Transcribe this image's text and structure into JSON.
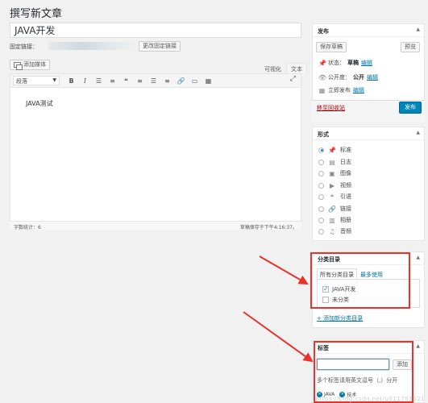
{
  "page": {
    "title": "撰写新文章"
  },
  "post": {
    "title_value": "JAVA开发",
    "permalink_label": "固定链接：",
    "change_permalink_label": "更改固定链接",
    "content": "JAVA测试"
  },
  "editor": {
    "add_media_label": "添加媒体",
    "tabs": [
      "可视化",
      "文本"
    ],
    "format_select": "段落",
    "toolbar_icons": [
      "bold-icon",
      "italic-icon",
      "bullet-list-icon",
      "numbered-list-icon",
      "blockquote-icon",
      "align-left-icon",
      "align-center-icon",
      "align-right-icon",
      "link-icon",
      "read-more-icon",
      "toolbar-toggle-icon",
      "fullscreen-icon"
    ],
    "word_count": "字数统计：6",
    "draft_saved": "草稿保存于下午4:16:37。"
  },
  "publish": {
    "header": "发布",
    "save_draft": "保存草稿",
    "preview": "预览",
    "status_label": "状态：",
    "status_value": "草稿",
    "visibility_label": "公开度：",
    "visibility_value": "公开",
    "schedule_label": "立即发布",
    "edit_link": "编辑",
    "trash_link": "移至回收站",
    "publish_button": "发布",
    "accent_color": "#0085ba"
  },
  "format": {
    "header": "形式",
    "items": [
      {
        "label": "标准",
        "icon": "pushpin-icon",
        "checked": true
      },
      {
        "label": "日志",
        "icon": "aside-icon",
        "checked": false
      },
      {
        "label": "图像",
        "icon": "image-icon",
        "checked": false
      },
      {
        "label": "视频",
        "icon": "video-icon",
        "checked": false
      },
      {
        "label": "引语",
        "icon": "quote-icon",
        "checked": false
      },
      {
        "label": "链接",
        "icon": "link-icon",
        "checked": false
      },
      {
        "label": "相册",
        "icon": "gallery-icon",
        "checked": false
      },
      {
        "label": "音频",
        "icon": "audio-icon",
        "checked": false
      }
    ]
  },
  "categories": {
    "header": "分类目录",
    "tab_all": "所有分类目录",
    "tab_popular": "最多使用",
    "items": [
      {
        "label": "JAVA开发",
        "checked": true
      },
      {
        "label": "未分类",
        "checked": false
      }
    ],
    "add_new": "+ 添加新分类目录"
  },
  "tags": {
    "header": "标签",
    "input_value": "",
    "add_button": "添加",
    "hint": "多个标签请用英文逗号（,）分开",
    "items": [
      "JAVA",
      "技术"
    ]
  },
  "watermark": "https://blog.csdn.net/u011781521",
  "highlight_color": "#e8322a"
}
